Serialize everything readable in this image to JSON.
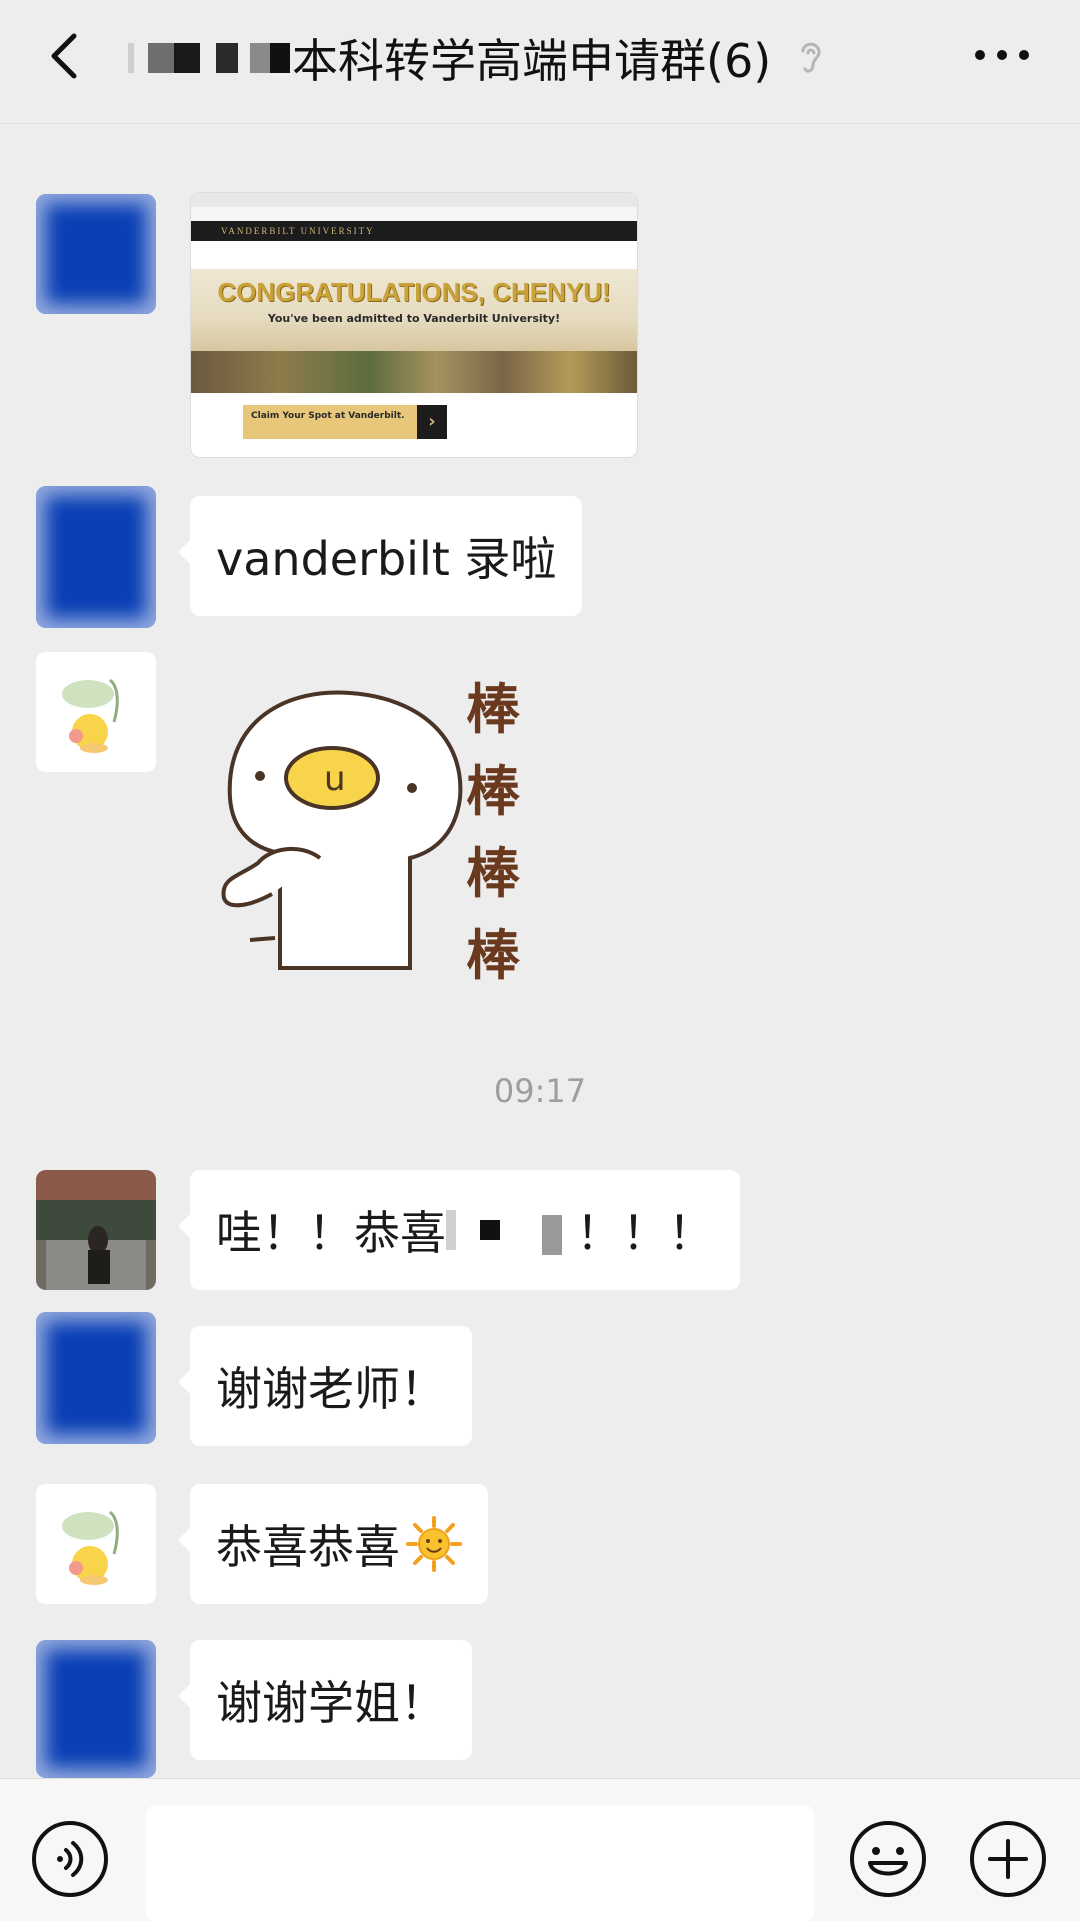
{
  "header": {
    "title": "本科转学高端申请群(6)"
  },
  "messages": {
    "m2_text": "vanderbilt 录啦",
    "m3_sticker_text": "棒",
    "time_label": "09:17",
    "m4_text": "哇！！恭喜",
    "m4_text_tail": "！！！",
    "m5_text": "谢谢老师！",
    "m6_text": "恭喜恭喜",
    "m7_text": "谢谢学姐！"
  },
  "admission_image": {
    "site_name": "VANDERBILT UNIVERSITY",
    "headline": "CONGRATULATIONS, CHENYU!",
    "subline": "You've been admitted to Vanderbilt University!",
    "claim_label": "Claim Your Spot at Vanderbilt."
  },
  "colors": {
    "background": "#ededed",
    "bubble": "#ffffff",
    "blue_avatar": "#0a3fb5"
  }
}
